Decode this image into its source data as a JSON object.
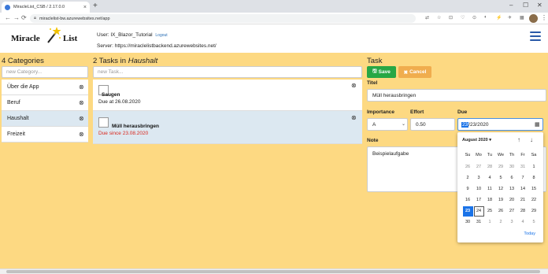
{
  "browser": {
    "tab_title": "MiracleList_CSB / 2.17.0.0",
    "tab_close": "×",
    "new_tab": "+",
    "window_controls": [
      "–",
      "☐",
      "✕"
    ],
    "nav": [
      "←",
      "→",
      "⟳"
    ],
    "lock_icon": "lock-icon",
    "url": "miraclelist-bw.azurewebsites.net/app",
    "extensions": [
      "⇄",
      "☆",
      "⊡",
      "♡",
      "⊙",
      "◐",
      "⚡",
      "✈",
      "▦"
    ]
  },
  "header": {
    "logo_left": "Miracle",
    "logo_right": "List",
    "user_prefix": "User: ",
    "user_name": "IX_Blazor_Tutorial",
    "logout": "Logout",
    "server": "Server: https://miraclelistbackend.azurewebsites.net/"
  },
  "categories": {
    "title": "4 Categories",
    "new_placeholder": "new Category...",
    "items": [
      {
        "label": "Über die App",
        "selected": false
      },
      {
        "label": "Beruf",
        "selected": false
      },
      {
        "label": "Haushalt",
        "selected": true
      },
      {
        "label": "Freizeit",
        "selected": false
      }
    ],
    "remove_icon": "⊗"
  },
  "tasks": {
    "title_prefix": "2 Tasks in ",
    "title_category": "Haushalt",
    "new_placeholder": "new Task...",
    "items": [
      {
        "name": "Saugen",
        "due": "Due at 26.08.2020",
        "overdue": false
      },
      {
        "name": "Müll herausbringen",
        "due": "Due since 23.08.2020",
        "overdue": true
      }
    ],
    "remove_icon": "⊗"
  },
  "task_detail": {
    "title": "Task",
    "save_label": "Save",
    "cancel_label": "Cancel",
    "titel_label": "Titel",
    "titel_value": "Müll herausbringen",
    "importance_label": "Importance",
    "importance_value": "A",
    "effort_label": "Effort",
    "effort_value": "0.50",
    "due_label": "Due",
    "due_day": "23",
    "due_rest": "/23/2020",
    "note_label": "Note",
    "note_value": "Beispielaufgabe",
    "colors": {
      "save": "#28a745",
      "cancel": "#f0ad4e",
      "selected_day": "#1a73e8",
      "overdue": "#d9261c"
    }
  },
  "calendar": {
    "month": "August 2020 ▾",
    "prev": "↑",
    "next": "↓",
    "weekdays": [
      "Su",
      "Mo",
      "Tu",
      "We",
      "Th",
      "Fr",
      "Sa"
    ],
    "days": [
      {
        "d": "26",
        "c": "o"
      },
      {
        "d": "27",
        "c": "o"
      },
      {
        "d": "28",
        "c": "o"
      },
      {
        "d": "29",
        "c": "o"
      },
      {
        "d": "30",
        "c": "o"
      },
      {
        "d": "31",
        "c": "o"
      },
      {
        "d": "1",
        "c": "c"
      },
      {
        "d": "2",
        "c": "c"
      },
      {
        "d": "3",
        "c": "c"
      },
      {
        "d": "4",
        "c": "c"
      },
      {
        "d": "5",
        "c": "c"
      },
      {
        "d": "6",
        "c": "c"
      },
      {
        "d": "7",
        "c": "c"
      },
      {
        "d": "8",
        "c": "c"
      },
      {
        "d": "9",
        "c": "c"
      },
      {
        "d": "10",
        "c": "c"
      },
      {
        "d": "11",
        "c": "c"
      },
      {
        "d": "12",
        "c": "c"
      },
      {
        "d": "13",
        "c": "c"
      },
      {
        "d": "14",
        "c": "c"
      },
      {
        "d": "15",
        "c": "c"
      },
      {
        "d": "16",
        "c": "c"
      },
      {
        "d": "17",
        "c": "c"
      },
      {
        "d": "18",
        "c": "c"
      },
      {
        "d": "19",
        "c": "c"
      },
      {
        "d": "20",
        "c": "c"
      },
      {
        "d": "21",
        "c": "c"
      },
      {
        "d": "22",
        "c": "c"
      },
      {
        "d": "23",
        "c": "sel"
      },
      {
        "d": "24",
        "c": "today"
      },
      {
        "d": "25",
        "c": "c"
      },
      {
        "d": "26",
        "c": "c"
      },
      {
        "d": "27",
        "c": "c"
      },
      {
        "d": "28",
        "c": "c"
      },
      {
        "d": "29",
        "c": "c"
      },
      {
        "d": "30",
        "c": "c"
      },
      {
        "d": "31",
        "c": "c"
      },
      {
        "d": "1",
        "c": "o"
      },
      {
        "d": "2",
        "c": "o"
      },
      {
        "d": "3",
        "c": "o"
      },
      {
        "d": "4",
        "c": "o"
      },
      {
        "d": "5",
        "c": "o"
      }
    ],
    "today_label": "Today"
  }
}
